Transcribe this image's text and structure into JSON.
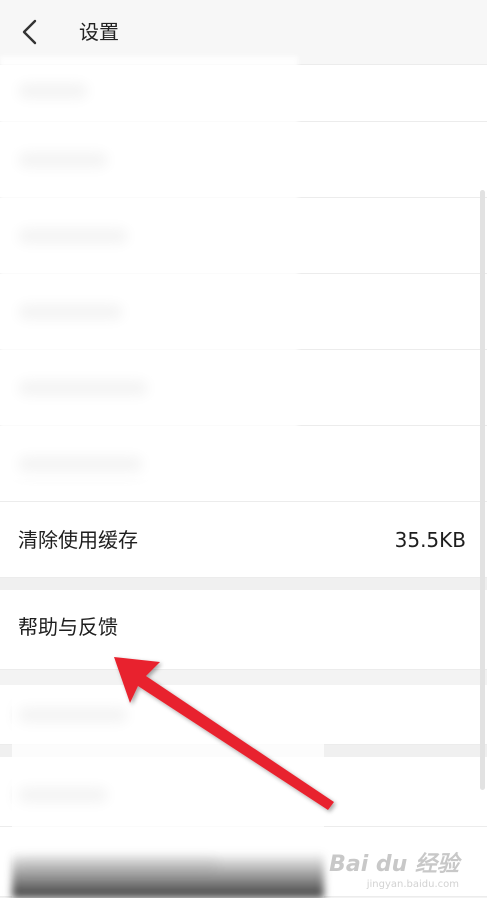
{
  "header": {
    "title": "设置",
    "back_icon": "chevron-left-icon"
  },
  "rows": {
    "clear_cache": {
      "label": "清除使用缓存",
      "value": "35.5KB"
    },
    "help_feedback": {
      "label": "帮助与反馈"
    }
  },
  "watermark": {
    "brand": "Bai du 经验",
    "site": "jingyan.baidu.com"
  },
  "colors": {
    "arrow": "#e8232f",
    "background": "#f3f3f3",
    "row": "#ffffff"
  }
}
